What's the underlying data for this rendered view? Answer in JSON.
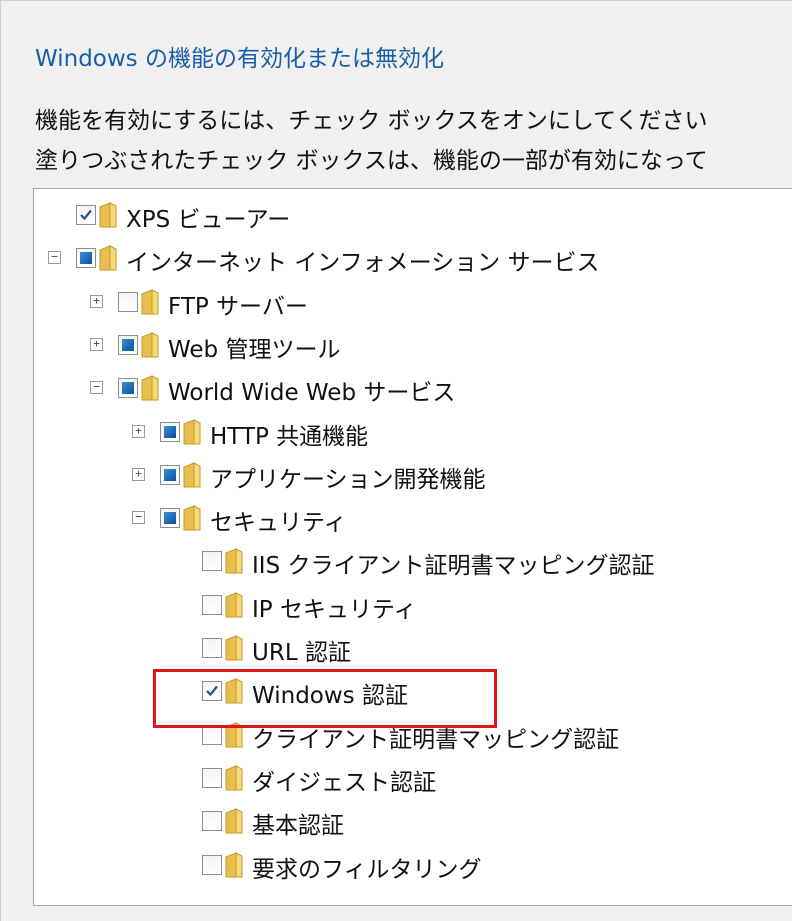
{
  "dialog": {
    "title": "Windows の機能の有効化または無効化",
    "description_line1": "機能を有効にするには、チェック ボックスをオンにしてください",
    "description_line2": "塗りつぶされたチェック ボックスは、機能の一部が有効になって"
  },
  "tree": [
    {
      "label": "XPS ビューアー",
      "level": 0,
      "expander": "none",
      "check": "checked"
    },
    {
      "label": "インターネット インフォメーション サービス",
      "level": 0,
      "expander": "collapse",
      "check": "partial"
    },
    {
      "label": "FTP サーバー",
      "level": 1,
      "expander": "expand",
      "check": "unchecked"
    },
    {
      "label": "Web 管理ツール",
      "level": 1,
      "expander": "expand",
      "check": "partial"
    },
    {
      "label": "World Wide Web サービス",
      "level": 1,
      "expander": "collapse",
      "check": "partial"
    },
    {
      "label": "HTTP 共通機能",
      "level": 2,
      "expander": "expand",
      "check": "partial"
    },
    {
      "label": "アプリケーション開発機能",
      "level": 2,
      "expander": "expand",
      "check": "partial"
    },
    {
      "label": "セキュリティ",
      "level": 2,
      "expander": "collapse",
      "check": "partial"
    },
    {
      "label": "IIS クライアント証明書マッピング認証",
      "level": 3,
      "expander": "none",
      "check": "unchecked"
    },
    {
      "label": "IP セキュリティ",
      "level": 3,
      "expander": "none",
      "check": "unchecked"
    },
    {
      "label": "URL 認証",
      "level": 3,
      "expander": "none",
      "check": "unchecked"
    },
    {
      "label": "Windows 認証",
      "level": 3,
      "expander": "none",
      "check": "checked",
      "highlighted": true
    },
    {
      "label": "クライアント証明書マッピング認証",
      "level": 3,
      "expander": "none",
      "check": "unchecked"
    },
    {
      "label": "ダイジェスト認証",
      "level": 3,
      "expander": "none",
      "check": "unchecked"
    },
    {
      "label": "基本認証",
      "level": 3,
      "expander": "none",
      "check": "unchecked"
    },
    {
      "label": "要求のフィルタリング",
      "level": 3,
      "expander": "none",
      "check": "unchecked"
    }
  ],
  "colors": {
    "title": "#1a5fa5",
    "highlight_border": "#e0161a",
    "partial_fill": "#1b6cc0",
    "folder": "#e8bf4f"
  }
}
